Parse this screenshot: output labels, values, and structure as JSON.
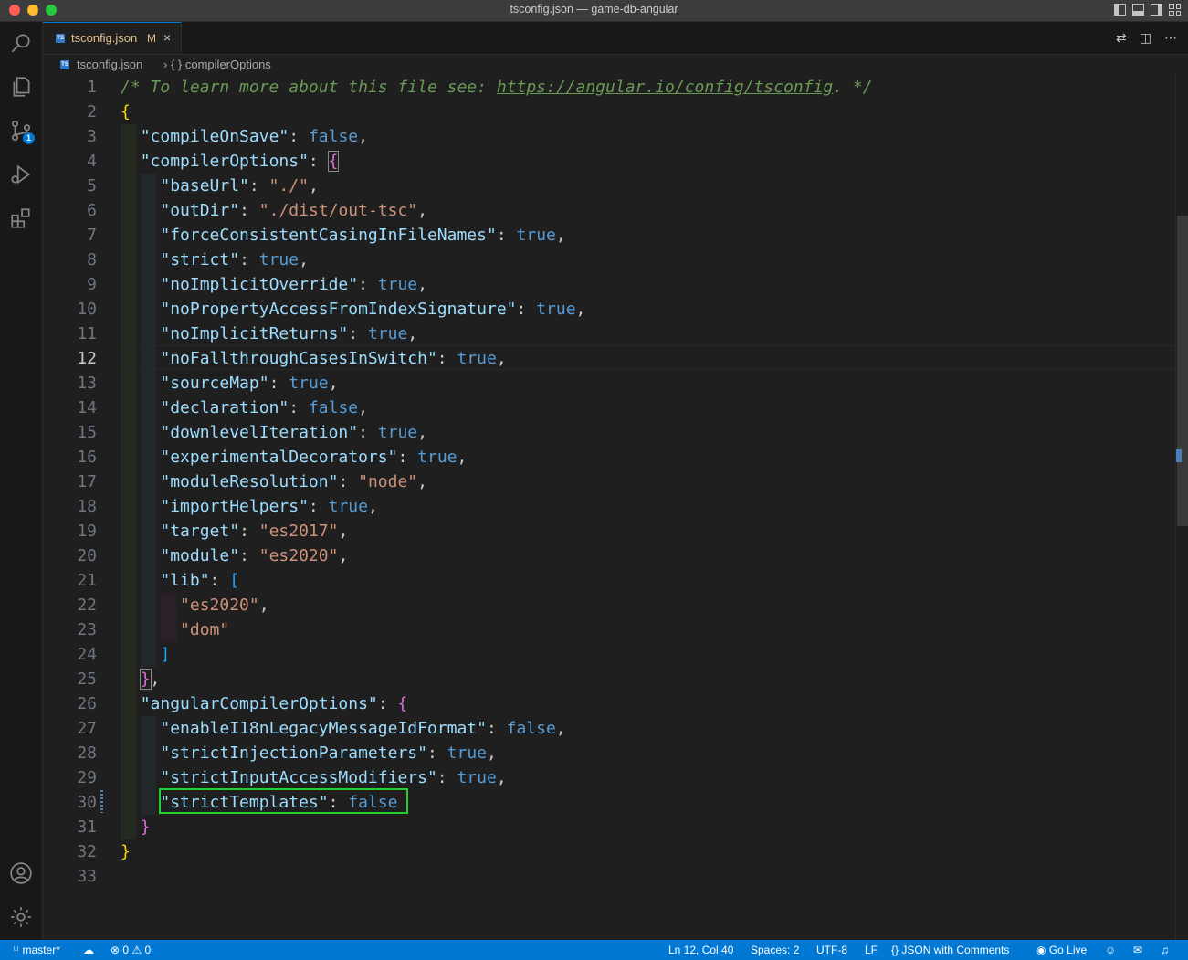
{
  "window": {
    "title": "tsconfig.json — game-db-angular"
  },
  "activity_bar": {
    "items": [
      "search-icon",
      "explorer-icon",
      "source-control-icon",
      "run-debug-icon",
      "extensions-icon"
    ],
    "source_control_badge": "1",
    "bottom_items": [
      "accounts-icon",
      "settings-gear-icon"
    ]
  },
  "tab": {
    "label": "tsconfig.json",
    "modified": "M",
    "file_icon": "TS",
    "close": "×"
  },
  "breadcrumbs": {
    "file": "tsconfig.json",
    "separator": "›",
    "symbol": "{ } compilerOptions"
  },
  "editor": {
    "active_line": 12,
    "lines": [
      "1",
      "2",
      "3",
      "4",
      "5",
      "6",
      "7",
      "8",
      "9",
      "10",
      "11",
      "12",
      "13",
      "14",
      "15",
      "16",
      "17",
      "18",
      "19",
      "20",
      "21",
      "22",
      "23",
      "24",
      "25",
      "26",
      "27",
      "28",
      "29",
      "30",
      "31",
      "32",
      "33"
    ],
    "code": {
      "l1_comment": "/* To learn more about this file see: ",
      "l1_url": "https://angular.io/config/tsconfig",
      "l1_end": ". */",
      "brace_open": "{",
      "brace_close": "}",
      "compileOnSave": "\"compileOnSave\"",
      "compilerOptions": "\"compilerOptions\"",
      "baseUrl": "\"baseUrl\"",
      "baseUrl_val": "\"./\"",
      "outDir": "\"outDir\"",
      "outDir_val": "\"./dist/out-tsc\"",
      "forceConsistent": "\"forceConsistentCasingInFileNames\"",
      "strict": "\"strict\"",
      "noImplicitOverride": "\"noImplicitOverride\"",
      "noPropertyAccess": "\"noPropertyAccessFromIndexSignature\"",
      "noImplicitReturns": "\"noImplicitReturns\"",
      "noFallthrough": "\"noFallthroughCasesInSwitch\"",
      "sourceMap": "\"sourceMap\"",
      "declaration": "\"declaration\"",
      "downlevelIteration": "\"downlevelIteration\"",
      "experimentalDecorators": "\"experimentalDecorators\"",
      "moduleResolution": "\"moduleResolution\"",
      "moduleResolution_val": "\"node\"",
      "importHelpers": "\"importHelpers\"",
      "target": "\"target\"",
      "target_val": "\"es2017\"",
      "module": "\"module\"",
      "module_val": "\"es2020\"",
      "lib": "\"lib\"",
      "lib_val1": "\"es2020\"",
      "lib_val2": "\"dom\"",
      "angularCompilerOptions": "\"angularCompilerOptions\"",
      "enableI18n": "\"enableI18nLegacyMessageIdFormat\"",
      "strictInjection": "\"strictInjectionParameters\"",
      "strictInputAccess": "\"strictInputAccessModifiers\"",
      "strictTemplates": "\"strictTemplates\"",
      "true": "true",
      "false": "false",
      "colon": ": ",
      "comma": ",",
      "bracket_open": "[",
      "bracket_close": "]"
    }
  },
  "status_bar": {
    "branch": "master*",
    "errors": "0",
    "warnings": "0",
    "position": "Ln 12, Col 40",
    "spaces": "Spaces: 2",
    "encoding": "UTF-8",
    "eol": "LF",
    "language": "JSON with Comments",
    "go_live": "Go Live"
  },
  "colors": {
    "accent": "#0078d4",
    "highlight_box": "#23d12d",
    "string": "#ce9178",
    "keyword": "#569cd6",
    "property": "#9cdcfe",
    "comment": "#6a9955"
  }
}
